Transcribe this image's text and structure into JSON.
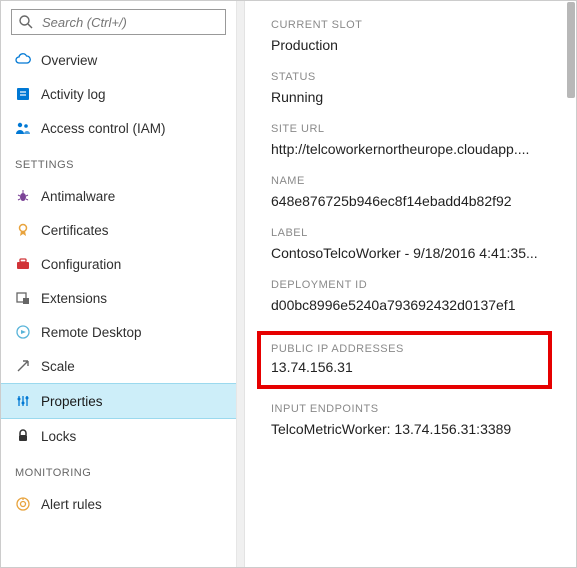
{
  "search": {
    "placeholder": "Search (Ctrl+/)"
  },
  "sidebar": {
    "top": [
      {
        "label": "Overview"
      },
      {
        "label": "Activity log"
      },
      {
        "label": "Access control (IAM)"
      }
    ],
    "settings_header": "Settings",
    "settings": [
      {
        "label": "Antimalware"
      },
      {
        "label": "Certificates"
      },
      {
        "label": "Configuration"
      },
      {
        "label": "Extensions"
      },
      {
        "label": "Remote Desktop"
      },
      {
        "label": "Scale"
      },
      {
        "label": "Properties"
      },
      {
        "label": "Locks"
      }
    ],
    "monitoring_header": "Monitoring",
    "monitoring": [
      {
        "label": "Alert rules"
      }
    ]
  },
  "detail": {
    "fields": [
      {
        "label": "Current slot",
        "value": "Production"
      },
      {
        "label": "Status",
        "value": "Running"
      },
      {
        "label": "Site URL",
        "value": "http://telcoworkernortheurope.cloudapp...."
      },
      {
        "label": "Name",
        "value": "648e876725b946ec8f14ebadd4b82f92"
      },
      {
        "label": "Label",
        "value": "ContosoTelcoWorker - 9/18/2016 4:41:35..."
      },
      {
        "label": "Deployment ID",
        "value": "d00bc8996e5240a793692432d0137ef1"
      },
      {
        "label": "Public IP addresses",
        "value": "13.74.156.31"
      },
      {
        "label": "Input endpoints",
        "value": "TelcoMetricWorker: 13.74.156.31:3389"
      }
    ]
  }
}
